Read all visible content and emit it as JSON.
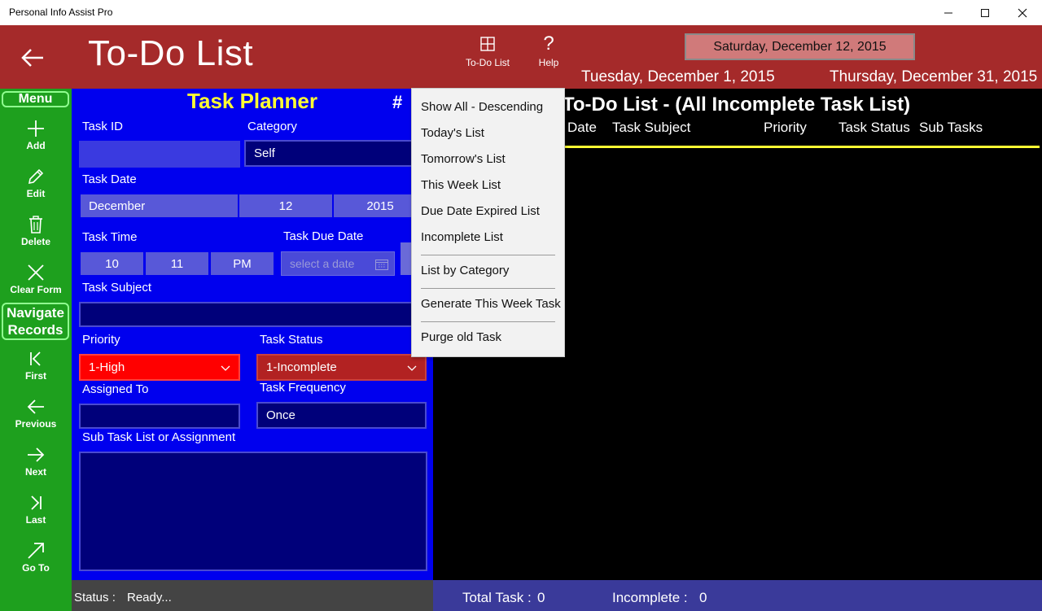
{
  "window": {
    "app_title": "Personal Info Assist Pro",
    "icons": {
      "minimize": "minimize-icon",
      "maximize": "maximize-icon",
      "close": "close-icon"
    }
  },
  "header": {
    "title": "To-Do List",
    "todo_button_label": "To-Do List",
    "help_button_label": "Help",
    "current_date": "Saturday, December 12, 2015",
    "range_start": "Tuesday, December 1, 2015",
    "range_end": "Thursday, December 31, 2015"
  },
  "sidebar": {
    "menu_label": "Menu",
    "add": "Add",
    "edit": "Edit",
    "delete": "Delete",
    "clear_form": "Clear Form",
    "navigate_label": "Navigate Records",
    "first": "First",
    "previous": "Previous",
    "next": "Next",
    "last": "Last",
    "go_to": "Go To"
  },
  "planner": {
    "title": "Task Planner",
    "hash": "#",
    "task_id_label": "Task ID",
    "task_id_value": "",
    "category_label": "Category",
    "category_value": "Self",
    "task_date_label": "Task Date",
    "task_date_month": "December",
    "task_date_day": "12",
    "task_date_year": "2015",
    "task_time_label": "Task Time",
    "task_time_hour": "10",
    "task_time_minute": "11",
    "task_time_ampm": "PM",
    "due_date_label": "Task Due Date",
    "due_date_placeholder": "select a date",
    "subject_label": "Task Subject",
    "subject_value": "",
    "priority_label": "Priority",
    "priority_value": "1-High",
    "status_label": "Task Status",
    "status_value": "1-Incomplete",
    "assigned_label": "Assigned To",
    "assigned_value": "",
    "frequency_label": "Task Frequency",
    "frequency_value": "Once",
    "subtask_label": "Sub Task List or Assignment",
    "subtask_value": ""
  },
  "list": {
    "title": "To-Do List - (All Incomplete Task List)",
    "columns": [
      "Date",
      "Task Subject",
      "Priority",
      "Task Status",
      "Sub Tasks"
    ]
  },
  "status": {
    "label": "Status :",
    "value": "Ready...",
    "total_label": "Total Task :",
    "total_value": "0",
    "incomplete_label": "Incomplete :",
    "incomplete_value": "0"
  },
  "dropdown": {
    "items": [
      "Show All - Descending",
      "Today's List",
      "Tomorrow's List",
      "This Week List",
      "Due Date Expired List",
      "Incomplete List",
      "List by Category",
      "Generate This Week Task",
      "Purge old Task"
    ]
  },
  "colors": {
    "header_bg": "#a52a2a",
    "sidebar_bg": "#1ea01e",
    "planner_bg": "#0000ee",
    "priority_bg": "#ff0000",
    "status_bg": "#b22222",
    "title_yellow": "#ffff33"
  }
}
